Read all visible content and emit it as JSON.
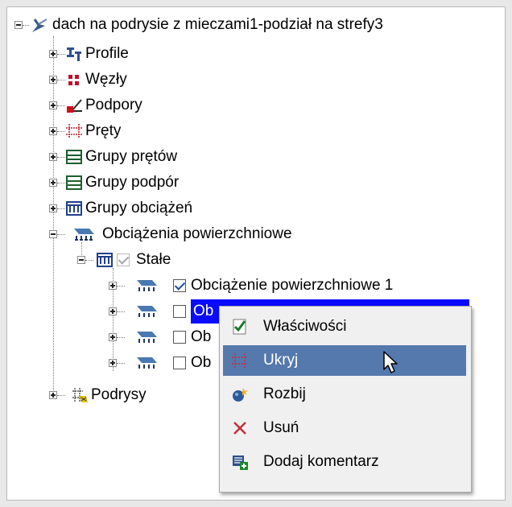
{
  "tree": {
    "root": {
      "label": "dach na podrysie z mieczami1-podział na strefy3",
      "icon": "structure-icon"
    },
    "items": [
      {
        "label": "Profile",
        "icon": "profile-icon"
      },
      {
        "label": "Węzły",
        "icon": "nodes-icon"
      },
      {
        "label": "Podpory",
        "icon": "supports-icon"
      },
      {
        "label": "Pręty",
        "icon": "bars-icon"
      },
      {
        "label": "Grupy prętów",
        "icon": "bar-groups-icon"
      },
      {
        "label": "Grupy podpór",
        "icon": "support-groups-icon"
      },
      {
        "label": "Grupy obciążeń",
        "icon": "load-groups-icon"
      },
      {
        "label": "Obciążenia powierzchniowe",
        "icon": "surface-loads-icon"
      },
      {
        "label": "Podrysy",
        "icon": "subdrawings-icon"
      }
    ],
    "group": {
      "label": "Stałe",
      "checked": true
    },
    "loads": [
      {
        "label": "Obciążenie powierzchniowe 1",
        "checked": true
      },
      {
        "label": "Ob",
        "checked": false,
        "selected": true
      },
      {
        "label": "Ob",
        "checked": false
      },
      {
        "label": "Ob",
        "checked": false
      }
    ]
  },
  "context_menu": {
    "items": [
      {
        "label": "Właściwości",
        "icon": "properties-icon"
      },
      {
        "label": "Ukryj",
        "icon": "hide-icon",
        "hover": true
      },
      {
        "label": "Rozbij",
        "icon": "explode-icon"
      },
      {
        "label": "Usuń",
        "icon": "delete-icon"
      },
      {
        "label": "Dodaj komentarz",
        "icon": "add-comment-icon"
      }
    ]
  }
}
